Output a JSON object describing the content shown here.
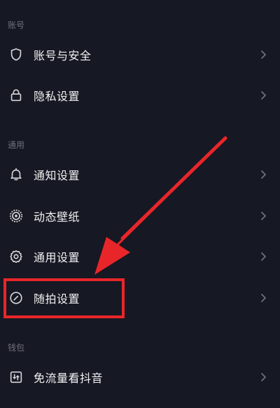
{
  "sections": {
    "account": "账号",
    "general": "通用",
    "wallet": "钱包"
  },
  "items": [
    {
      "label": "账号与安全",
      "icon": "shield-icon"
    },
    {
      "label": "隐私设置",
      "icon": "lock-icon"
    },
    {
      "label": "通知设置",
      "icon": "bell-icon"
    },
    {
      "label": "动态壁纸",
      "icon": "live-wallpaper-icon"
    },
    {
      "label": "通用设置",
      "icon": "gear-icon"
    },
    {
      "label": "随拍设置",
      "icon": "snapshot-icon"
    },
    {
      "label": "免流量看抖音",
      "icon": "data-free-icon"
    }
  ],
  "colors": {
    "background": "#161823",
    "text": "#f2f2f3",
    "section_header": "#6f7079",
    "icon": "#d5d5d8",
    "chevron": "#6f7079",
    "annotation": "#e8262a"
  }
}
